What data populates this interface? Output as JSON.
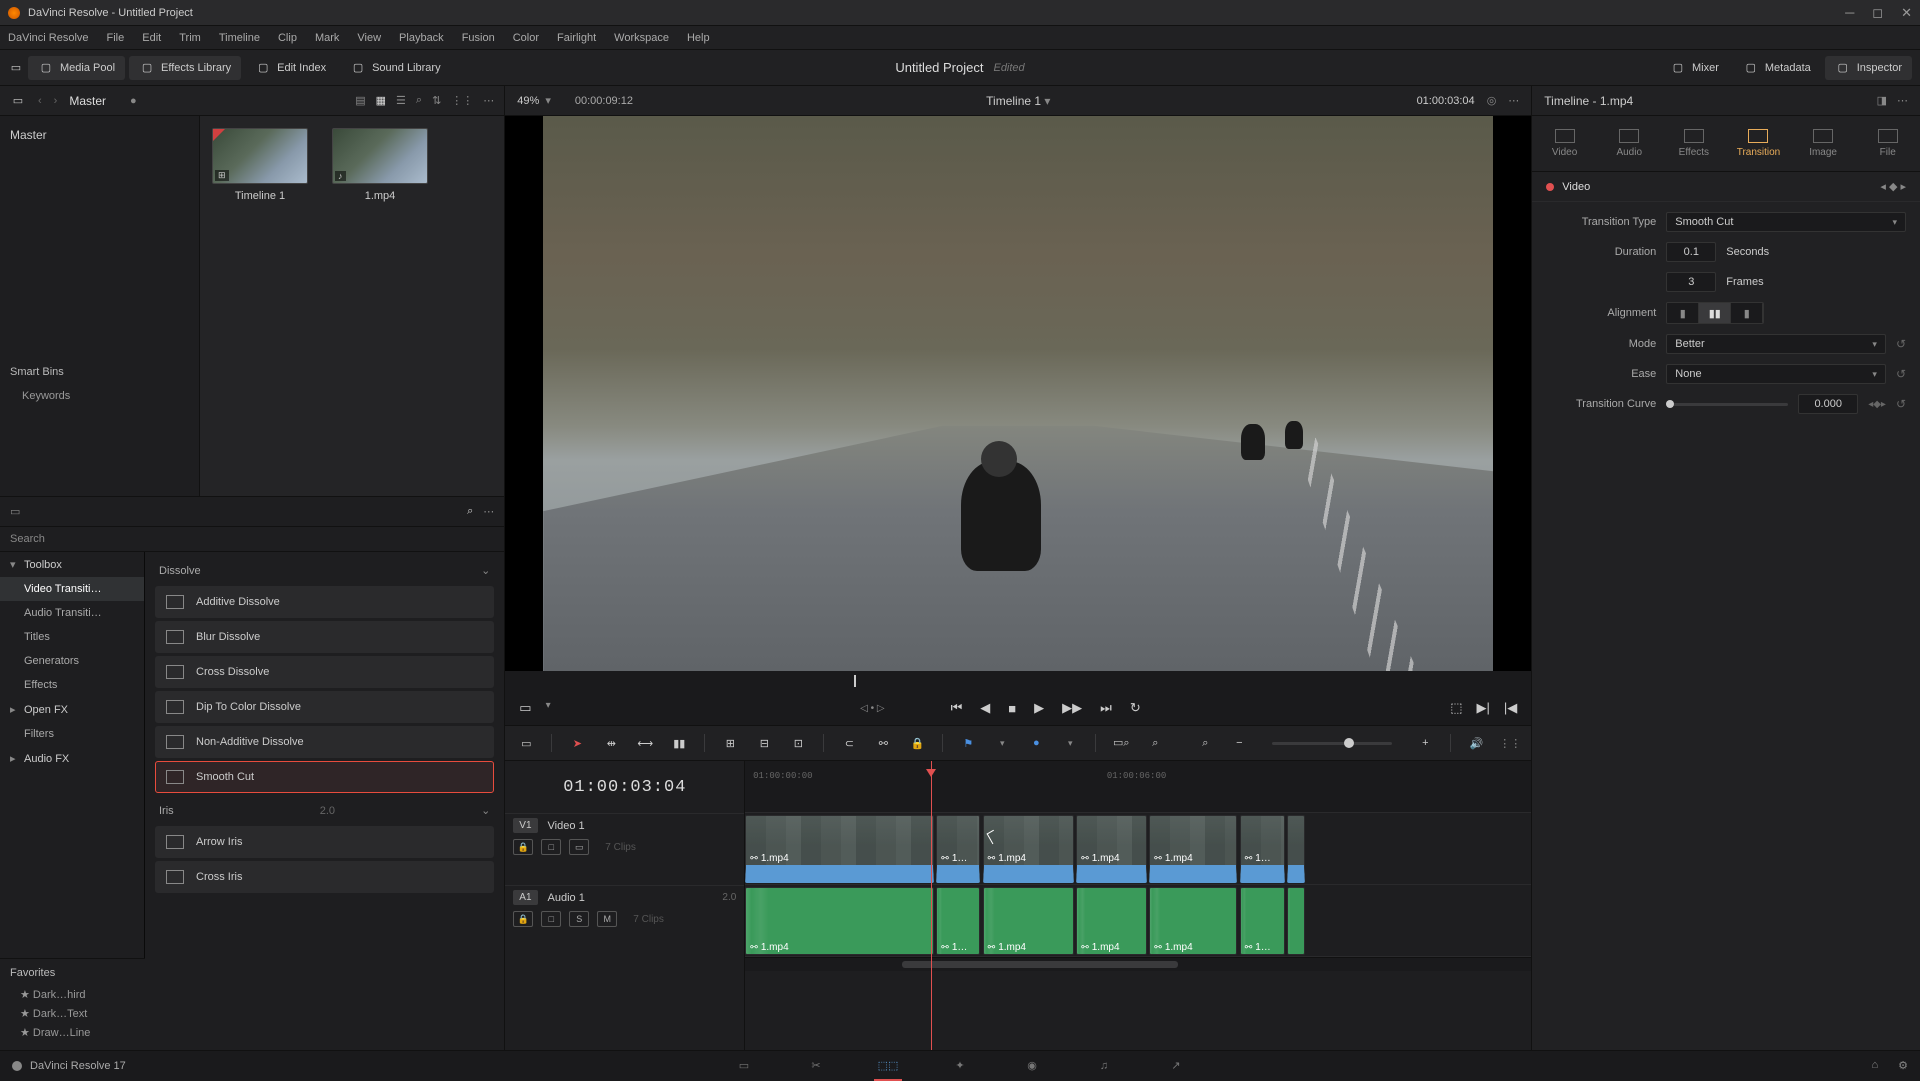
{
  "window": {
    "title": "DaVinci Resolve - Untitled Project"
  },
  "menu": [
    "DaVinci Resolve",
    "File",
    "Edit",
    "Trim",
    "Timeline",
    "Clip",
    "Mark",
    "View",
    "Playback",
    "Fusion",
    "Color",
    "Fairlight",
    "Workspace",
    "Help"
  ],
  "shelf": {
    "left": [
      {
        "label": "Media Pool",
        "active": true
      },
      {
        "label": "Effects Library",
        "active": true
      },
      {
        "label": "Edit Index",
        "active": false
      },
      {
        "label": "Sound Library",
        "active": false
      }
    ],
    "project": "Untitled Project",
    "state": "Edited",
    "right": [
      {
        "label": "Mixer"
      },
      {
        "label": "Metadata"
      },
      {
        "label": "Inspector",
        "active": true
      }
    ]
  },
  "pool": {
    "breadcrumb": "Master",
    "tree": {
      "root": "Master",
      "smart_h": "Smart Bins",
      "smart_items": [
        "Keywords"
      ]
    },
    "thumbs": [
      {
        "label": "Timeline 1",
        "kind": "timeline"
      },
      {
        "label": "1.mp4",
        "kind": "clip"
      }
    ]
  },
  "viewer": {
    "zoom": "49%",
    "src_tc": "00:00:09:12",
    "timeline_name": "Timeline 1",
    "rec_tc": "01:00:03:04"
  },
  "fx": {
    "search_ph": "Search",
    "tree": [
      {
        "lvl": 1,
        "label": "Toolbox",
        "chev": "▾"
      },
      {
        "lvl": 2,
        "label": "Video Transiti…",
        "sel": true
      },
      {
        "lvl": 2,
        "label": "Audio Transiti…"
      },
      {
        "lvl": 2,
        "label": "Titles"
      },
      {
        "lvl": 2,
        "label": "Generators"
      },
      {
        "lvl": 2,
        "label": "Effects"
      },
      {
        "lvl": 1,
        "label": "Open FX",
        "chev": "▸"
      },
      {
        "lvl": 2,
        "label": "Filters"
      },
      {
        "lvl": 1,
        "label": "Audio FX",
        "chev": "▸"
      }
    ],
    "groups": [
      {
        "header": "Dissolve",
        "items": [
          {
            "label": "Additive Dissolve"
          },
          {
            "label": "Blur Dissolve"
          },
          {
            "label": "Cross Dissolve"
          },
          {
            "label": "Dip To Color Dissolve"
          },
          {
            "label": "Non-Additive Dissolve"
          },
          {
            "label": "Smooth Cut",
            "sel": true
          }
        ]
      },
      {
        "header": "Iris",
        "meta": "2.0",
        "items": [
          {
            "label": "Arrow Iris"
          },
          {
            "label": "Cross Iris"
          }
        ]
      }
    ],
    "fav_h": "Favorites",
    "favs": [
      "Dark…hird",
      "Dark…Text",
      "Draw…Line"
    ]
  },
  "timeline": {
    "tc": "01:00:03:04",
    "tracks": [
      {
        "tag": "V1",
        "name": "Video 1",
        "meta": "",
        "icons": [
          "🔒",
          "□",
          "▭"
        ]
      },
      {
        "tag": "A1",
        "name": "Audio 1",
        "meta": "2.0",
        "icons": [
          "🔒",
          "□",
          "S",
          "M"
        ]
      }
    ],
    "ruler": [
      "01:00:00:00",
      "01:00:06:00"
    ],
    "video_clips": [
      {
        "l": 0,
        "w": 24,
        "label": "1.mp4"
      },
      {
        "l": 24.3,
        "w": 5.6,
        "label": "1…"
      },
      {
        "l": 30.2,
        "w": 11.6,
        "label": "1.mp4"
      },
      {
        "l": 42.1,
        "w": 9,
        "label": "1.mp4"
      },
      {
        "l": 51.4,
        "w": 11.2,
        "label": "1.mp4"
      },
      {
        "l": 62.9,
        "w": 5.8,
        "label": "1…"
      },
      {
        "l": 68.9,
        "w": 2.3,
        "label": ""
      }
    ],
    "audio_clips": [
      {
        "l": 0,
        "w": 24,
        "label": "1.mp4"
      },
      {
        "l": 24.3,
        "w": 5.6,
        "label": "1…"
      },
      {
        "l": 30.2,
        "w": 11.6,
        "label": "1.mp4"
      },
      {
        "l": 42.1,
        "w": 9,
        "label": "1.mp4"
      },
      {
        "l": 51.4,
        "w": 11.2,
        "label": "1.mp4"
      },
      {
        "l": 62.9,
        "w": 5.8,
        "label": "1…"
      },
      {
        "l": 68.9,
        "w": 2.3,
        "label": ""
      }
    ],
    "playhead_pct": 23.6
  },
  "inspector": {
    "clip": "Timeline - 1.mp4",
    "tabs": [
      "Video",
      "Audio",
      "Effects",
      "Transition",
      "Image",
      "File"
    ],
    "active_tab": "Transition",
    "section": "Video",
    "props": {
      "type_label": "Transition Type",
      "type_value": "Smooth Cut",
      "dur_label": "Duration",
      "dur_sec": "0.1",
      "dur_sec_u": "Seconds",
      "dur_fr": "3",
      "dur_fr_u": "Frames",
      "align_label": "Alignment",
      "mode_label": "Mode",
      "mode_value": "Better",
      "ease_label": "Ease",
      "ease_value": "None",
      "curve_label": "Transition Curve",
      "curve_value": "0.000"
    }
  },
  "pagebar": {
    "app": "DaVinci Resolve 17"
  }
}
